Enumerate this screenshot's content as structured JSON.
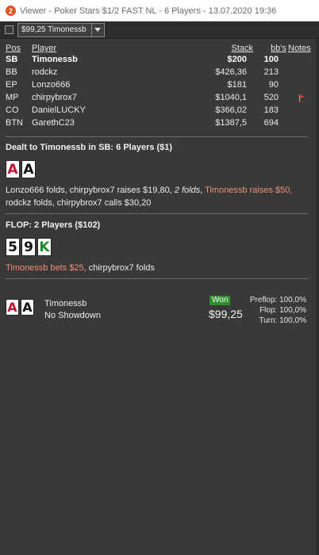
{
  "window": {
    "app_icon_text": "2",
    "title": "Viewer - Poker Stars $1/2 FAST NL - 6 Players - 13.07.2020 19:36"
  },
  "toolbar": {
    "hand_select_value": "$99,25 Timonessb"
  },
  "players_table": {
    "headers": {
      "pos": "Pos",
      "player": "Player",
      "stack": "Stack",
      "bbs": "bb's",
      "notes": "Notes"
    },
    "rows": [
      {
        "pos": "SB",
        "player": "Timonessb",
        "stack": "$200",
        "bbs": "100",
        "hero": true
      },
      {
        "pos": "BB",
        "player": "rodckz",
        "stack": "$426,36",
        "bbs": "213"
      },
      {
        "pos": "EP",
        "player": "Lonzo666",
        "stack": "$181",
        "bbs": "90"
      },
      {
        "pos": "MP",
        "player": "chirpybrox7",
        "stack": "$1040,1",
        "bbs": "520",
        "note_icon": "red-flag-icon"
      },
      {
        "pos": "CO",
        "player": "DanielLUCKY",
        "stack": "$366,02",
        "bbs": "183"
      },
      {
        "pos": "BTN",
        "player": "GarethC23",
        "stack": "$1387,5",
        "bbs": "694"
      }
    ]
  },
  "preflop": {
    "title": "Dealt to Timonessb in SB: 6 Players ($1)",
    "hole_cards": [
      {
        "rank": "A",
        "color": "#c8102e"
      },
      {
        "rank": "A",
        "color": "#111111"
      }
    ],
    "line1": {
      "a": "Lonzo666 folds, chirpybrox7 raises $19,80, ",
      "b": "2 folds",
      "c": ", ",
      "d": "Timonessb raises $50,"
    },
    "line2": "rodckz folds, chirpybrox7 calls $30,20"
  },
  "flop": {
    "title": "FLOP: 2 Players ($102)",
    "board": [
      {
        "rank": "5",
        "color": "#111111"
      },
      {
        "rank": "9",
        "color": "#111111"
      },
      {
        "rank": "K",
        "color": "#1c8c2c"
      }
    ],
    "line_hero": "Timonessb bets $25,",
    "line_rest": " chirpybrox7 folds"
  },
  "result": {
    "cards": [
      {
        "rank": "A",
        "color": "#c8102e"
      },
      {
        "rank": "A",
        "color": "#111111"
      }
    ],
    "player": "Timonessb",
    "showdown": "No Showdown",
    "won_label": "Won",
    "won_amount": "$99,25",
    "equity": {
      "preflop": "Preflop: 100,0%",
      "flop": "Flop: 100,0%",
      "turn": "Turn: 100,0%"
    }
  },
  "colors": {
    "hero_action": "#f0907a",
    "won_badge": "#2f8f2f",
    "background": "#393939"
  }
}
